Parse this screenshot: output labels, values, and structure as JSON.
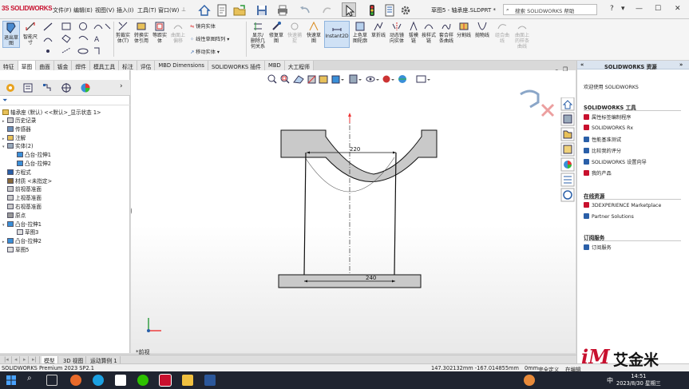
{
  "titlebar": {
    "logo_ds": "3S",
    "logo_text": "SOLIDWORKS",
    "menus": [
      "文件(F)",
      "编辑(E)",
      "视图(V)",
      "插入(I)",
      "工具(T)",
      "窗口(W)"
    ],
    "doc_title": "草图5 - 轴承座.SLDPRT *",
    "search_placeholder": "搜索 SOLIDWORKS 帮助"
  },
  "ribbon": {
    "big": [
      {
        "label": "退出草\n图",
        "icon": "exit-sketch-icon"
      },
      {
        "label": "智能尺\n寸",
        "icon": "smart-dimension-icon"
      }
    ],
    "tools": [
      {
        "label": "剪裁实\n体(T)"
      },
      {
        "label": "转换实\n体引用"
      },
      {
        "label": "等距实\n体"
      },
      {
        "label": "曲面上\n偏移"
      }
    ],
    "mirror": "镜向实体",
    "linear_pattern": "线性草图阵列",
    "move": "移动实体",
    "tools2": [
      {
        "label": "显示/\n删除几\n何关系"
      },
      {
        "label": "修复草\n图"
      },
      {
        "label": "快速捕\n捉"
      },
      {
        "label": "快速草\n图"
      },
      {
        "label": "Instant2D"
      },
      {
        "label": "上色草\n图轮廓"
      },
      {
        "label": "草折线"
      },
      {
        "label": "动态镜\n向实体"
      },
      {
        "label": "拔模\n链"
      },
      {
        "label": "按样式\n链"
      },
      {
        "label": "套合样\n条曲线"
      },
      {
        "label": "分割线"
      },
      {
        "label": "抛物线"
      },
      {
        "label": "组合曲\n线"
      },
      {
        "label": "曲面上\n的样条\n曲线"
      }
    ]
  },
  "command_tabs": [
    "特征",
    "草图",
    "曲面",
    "钣金",
    "焊件",
    "模具工具",
    "标注",
    "评估",
    "MBD Dimensions",
    "SOLIDWORKS 插件",
    "MBD",
    "大工程师"
  ],
  "active_command_tab": "草图",
  "tree": {
    "root": "轴承座 (默认) <<默认>_显示状态 1>",
    "items": [
      {
        "label": "历史记录",
        "indent": 1,
        "arrow": "▸"
      },
      {
        "label": "传感器",
        "indent": 1,
        "arrow": ""
      },
      {
        "label": "注解",
        "indent": 1,
        "arrow": "▸"
      },
      {
        "label": "实体(2)",
        "indent": 1,
        "arrow": "▾"
      },
      {
        "label": "凸台-拉伸1",
        "indent": 2,
        "arrow": ""
      },
      {
        "label": "凸台-拉伸2",
        "indent": 2,
        "arrow": ""
      },
      {
        "label": "方程式",
        "indent": 1,
        "arrow": ""
      },
      {
        "label": "材质 <未指定>",
        "indent": 1,
        "arrow": ""
      },
      {
        "label": "前视基准面",
        "indent": 1,
        "arrow": ""
      },
      {
        "label": "上视基准面",
        "indent": 1,
        "arrow": ""
      },
      {
        "label": "右视基准面",
        "indent": 1,
        "arrow": ""
      },
      {
        "label": "原点",
        "indent": 1,
        "arrow": ""
      },
      {
        "label": "凸台-拉伸1",
        "indent": 1,
        "arrow": "▾"
      },
      {
        "label": "草图3",
        "indent": 2,
        "arrow": ""
      },
      {
        "label": "凸台-拉伸2",
        "indent": 1,
        "arrow": "▸"
      },
      {
        "label": "草图5",
        "indent": 1,
        "arrow": ""
      }
    ]
  },
  "viewport": {
    "dim_top": "220",
    "dim_bottom": "240",
    "view_name": "*前视"
  },
  "bottom_tabs": [
    "模型",
    "3D 视图",
    "运动算例 1"
  ],
  "active_bottom_tab": "模型",
  "status": {
    "product": "SOLIDWORKS Premium 2023 SP2.1",
    "coords": "147.302132mm   -167.014855mm",
    "z": "0mm",
    "state": "完全定义",
    "editing": "在编辑"
  },
  "task_pane": {
    "title": "SOLIDWORKS 资源",
    "welcome": "欢迎使用 SOLIDWORKS",
    "sections": [
      {
        "title": "SOLIDWORKS 工具",
        "items": [
          "属性标签编制程序",
          "SOLIDWORKS Rx",
          "性能基准测试",
          "比较我的评分",
          "SOLIDWORKS 设置向导",
          "我的产品"
        ]
      },
      {
        "title": "在线资源",
        "items": [
          "3DEXPERIENCE Marketplace",
          "Partner Solutions"
        ]
      },
      {
        "title": "订阅服务",
        "items": [
          "订阅服务"
        ]
      }
    ]
  },
  "taskbar": {
    "ime": "中",
    "time": "14:51",
    "date": "2023/8/30 星期三"
  },
  "watermark": {
    "brand": "iM",
    "text": "艾金米"
  }
}
